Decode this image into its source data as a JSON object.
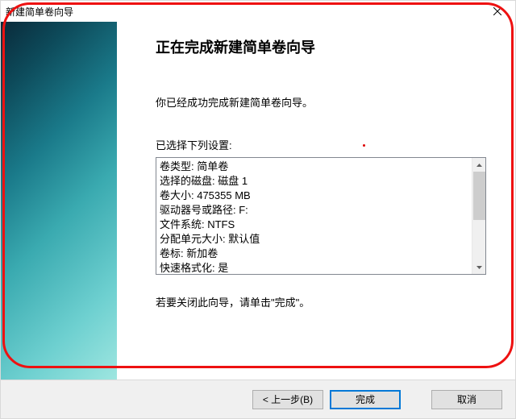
{
  "window": {
    "title": "新建简单卷向导"
  },
  "content": {
    "heading": "正在完成新建简单卷向导",
    "intro": "你已经成功完成新建简单卷向导。",
    "settings_label": "已选择下列设置:",
    "settings": [
      "卷类型: 简单卷",
      "选择的磁盘: 磁盘 1",
      "卷大小: 475355 MB",
      "驱动器号或路径: F:",
      "文件系统: NTFS",
      "分配单元大小: 默认值",
      "卷标: 新加卷",
      "快速格式化: 是"
    ],
    "closing": "若要关闭此向导，请单击\"完成\"。"
  },
  "buttons": {
    "back": "< 上一步(B)",
    "finish": "完成",
    "cancel": "取消"
  }
}
